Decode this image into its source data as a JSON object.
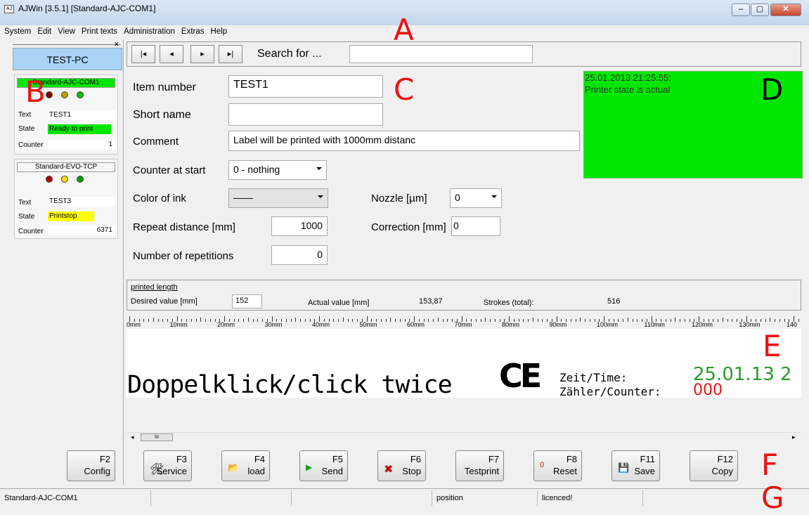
{
  "window": {
    "title": "AJWin [3.5.1]  [Standard-AJC-COM1]",
    "min_glyph": "–",
    "max_glyph": "▢",
    "close_glyph": "✕"
  },
  "menu": [
    "System",
    "Edit",
    "View",
    "Print texts",
    "Administration",
    "Extras",
    "Help"
  ],
  "annotations": [
    "A",
    "B",
    "C",
    "D",
    "E",
    "F",
    "G"
  ],
  "left_panel": {
    "pc_name": "TEST-PC",
    "printers": [
      {
        "name": "Standard-AJC-COM1",
        "title_color": "#00e600",
        "leds": [
          "#8b0000",
          "#b8a000",
          "#00c000"
        ],
        "text": "TEST1",
        "state": "Ready to print",
        "state_color": "#00e600",
        "counter": "1",
        "labels": {
          "text": "Text",
          "state": "State",
          "counter": "Counter"
        }
      },
      {
        "name": "Standard-EVO-TCP",
        "title_color": "#f6f6f6",
        "leds": [
          "#b00000",
          "#f0e000",
          "#00a000"
        ],
        "text": "TEST3",
        "state": "Printstop",
        "state_color": "#ffff00",
        "counter": "6371",
        "labels": {
          "text": "Text",
          "state": "State",
          "counter": "Counter"
        }
      }
    ]
  },
  "nav": {
    "first": "|◂",
    "prev": "◂",
    "next": "▸",
    "last": "▸|",
    "search_label": "Search for ...",
    "search_value": ""
  },
  "form": {
    "item_number_label": "Item number",
    "item_number": "TEST1",
    "short_name_label": "Short name",
    "short_name": "",
    "comment_label": "Comment",
    "comment": "Label will be printed with 1000mm distanc",
    "counter_label": "Counter at start",
    "counter_value": "0 - nothing",
    "ink_label": "Color of ink",
    "ink_value": "——",
    "nozzle_label": "Nozzle [µm]",
    "nozzle_value": "0",
    "repeat_label": "Repeat distance [mm]",
    "repeat_value": "1000",
    "correction_label": "Correction [mm]",
    "correction_value": "0",
    "repetitions_label": "Number of repetitions",
    "repetitions_value": "0"
  },
  "status_box": {
    "time": "25.01.2013 21:25:55:",
    "message": "Printer state is actual",
    "color": "#00e600"
  },
  "printed_length": {
    "title": "printed length",
    "desired_label": "Desired value [mm]",
    "desired_value": "152",
    "actual_label": "Actual value [mm]",
    "actual_value": "153,87",
    "strokes_label": "Strokes (total):",
    "strokes_value": "516"
  },
  "ruler": [
    "0mm",
    "10mm",
    "20mm",
    "30mm",
    "40mm",
    "50mm",
    "60mm",
    "70mm",
    "80mm",
    "90mm",
    "100mm",
    "110mm",
    "120mm",
    "130mm",
    "140"
  ],
  "preview": {
    "main_text": "Doppelklick/click twice",
    "ce": "CE",
    "time_label": "Zeit/Time:",
    "counter_label": "Zähler/Counter:",
    "date_value": "25.01.13 2",
    "counter_value": "000"
  },
  "scroll": {
    "left": "◂",
    "thumb": "III",
    "right": "▸"
  },
  "fkeys": [
    {
      "key": "F2",
      "label": "Config",
      "icon": ""
    },
    {
      "key": "F3",
      "label": "Service",
      "icon": "🛠"
    },
    {
      "key": "F4",
      "label": "load",
      "icon": "📂"
    },
    {
      "key": "F5",
      "label": "Send",
      "icon": "▶"
    },
    {
      "key": "F6",
      "label": "Stop",
      "icon": "✖"
    },
    {
      "key": "F7",
      "label": "Testprint",
      "icon": ""
    },
    {
      "key": "F8",
      "label": "Reset",
      "icon": "0"
    },
    {
      "key": "F11",
      "label": "Save",
      "icon": "💾"
    },
    {
      "key": "F12",
      "label": "Copy",
      "icon": ""
    }
  ],
  "statusbar": {
    "printer": "Standard-AJC-COM1",
    "position": "position",
    "license": "licenced!"
  }
}
